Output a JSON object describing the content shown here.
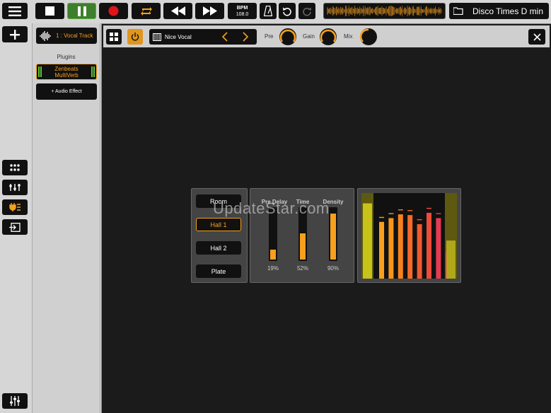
{
  "transport": {
    "bpm_label": "BPM",
    "bpm_value": "108.0",
    "song_title": "Disco Times D min"
  },
  "track_panel": {
    "track_name": "1 : Vocal Track",
    "plugins_heading": "Plugins",
    "plugin_name_line1": "Zenbeats",
    "plugin_name_line2": "MultiVerb",
    "add_effect_label": "+ Audio Effect"
  },
  "plugin_header": {
    "preset_name": "Nice Vocal",
    "knobs": [
      {
        "label": "Pre"
      },
      {
        "label": "Gain"
      },
      {
        "label": "Mix"
      }
    ]
  },
  "reverb": {
    "types": [
      {
        "label": "Room",
        "selected": false
      },
      {
        "label": "Hall 1",
        "selected": true
      },
      {
        "label": "Hall 2",
        "selected": false
      },
      {
        "label": "Plate",
        "selected": false
      }
    ],
    "faders": [
      {
        "label": "Pre Delay",
        "value": "19%",
        "fraction": 0.19
      },
      {
        "label": "Time",
        "value": "52%",
        "fraction": 0.52
      },
      {
        "label": "Density",
        "value": "90%",
        "fraction": 0.9
      }
    ],
    "meter_levels": [
      0.88,
      0.75,
      0.8,
      0.85,
      0.84,
      0.72,
      0.87,
      0.8,
      0.36,
      0.89
    ],
    "watermark": "UpdateStar.com"
  },
  "colors": {
    "accent": "#f7a01e",
    "green_active": "#3e7f2d",
    "record": "#e0121a"
  }
}
